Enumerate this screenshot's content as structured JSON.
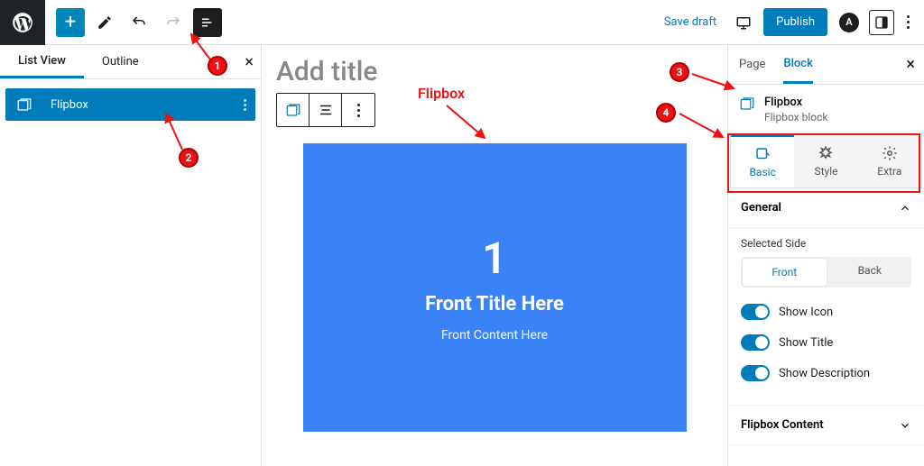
{
  "topbar": {
    "save_draft": "Save draft",
    "publish": "Publish"
  },
  "left_sidebar": {
    "tabs": {
      "list_view": "List View",
      "outline": "Outline"
    },
    "selected_block": "Flipbox"
  },
  "editor": {
    "title_placeholder": "Add title",
    "flipbox": {
      "number": "1",
      "title": "Front Title Here",
      "content": "Front Content Here"
    }
  },
  "right_sidebar": {
    "tabs": {
      "page": "Page",
      "block": "Block"
    },
    "block_name": "Flipbox",
    "block_desc": "Flipbox block",
    "sub_tabs": {
      "basic": "Basic",
      "style": "Style",
      "extra": "Extra"
    },
    "sections": {
      "general": "General",
      "selected_side_label": "Selected Side",
      "side_front": "Front",
      "side_back": "Back",
      "show_icon": "Show Icon",
      "show_title": "Show Title",
      "show_desc": "Show Description",
      "flipbox_content": "Flipbox Content"
    }
  },
  "annotations": {
    "flipbox_label": "Flipbox",
    "n1": "1",
    "n2": "2",
    "n3": "3",
    "n4": "4"
  }
}
